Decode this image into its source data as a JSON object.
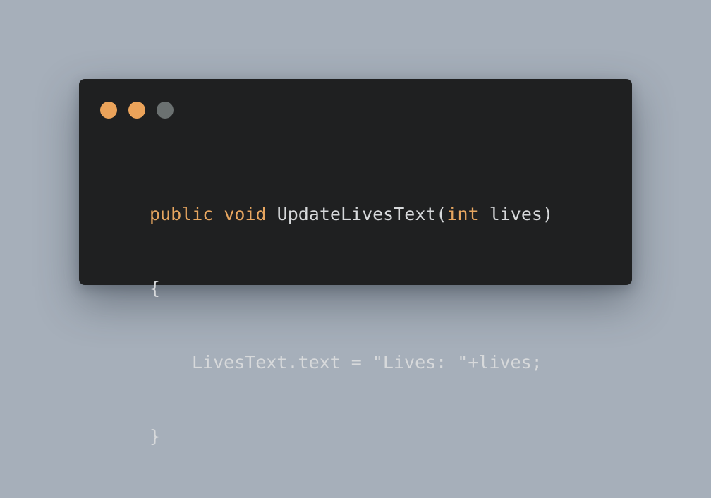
{
  "colors": {
    "background": "#a6afba",
    "window_bg": "#1f2021",
    "keyword": "#e7a660",
    "text": "#d7d9db",
    "dot_1": "#eba35a",
    "dot_2": "#eba35a",
    "dot_3": "#6b7171"
  },
  "window": {
    "controls": [
      {
        "name": "close-dot-icon",
        "color": "#eba35a"
      },
      {
        "name": "minimize-dot-icon",
        "color": "#eba35a"
      },
      {
        "name": "maximize-dot-icon",
        "color": "#6b7171"
      }
    ]
  },
  "code": {
    "line1": {
      "kw_public": "public",
      "sp1": " ",
      "kw_void": "void",
      "sp2": " ",
      "method": "UpdateLivesText(",
      "kw_int": "int",
      "params": " lives)"
    },
    "line2": {
      "text": "{"
    },
    "line3": {
      "text": "LivesText.text = \"Lives: \"+lives;"
    },
    "line4": {
      "text": "}"
    }
  }
}
